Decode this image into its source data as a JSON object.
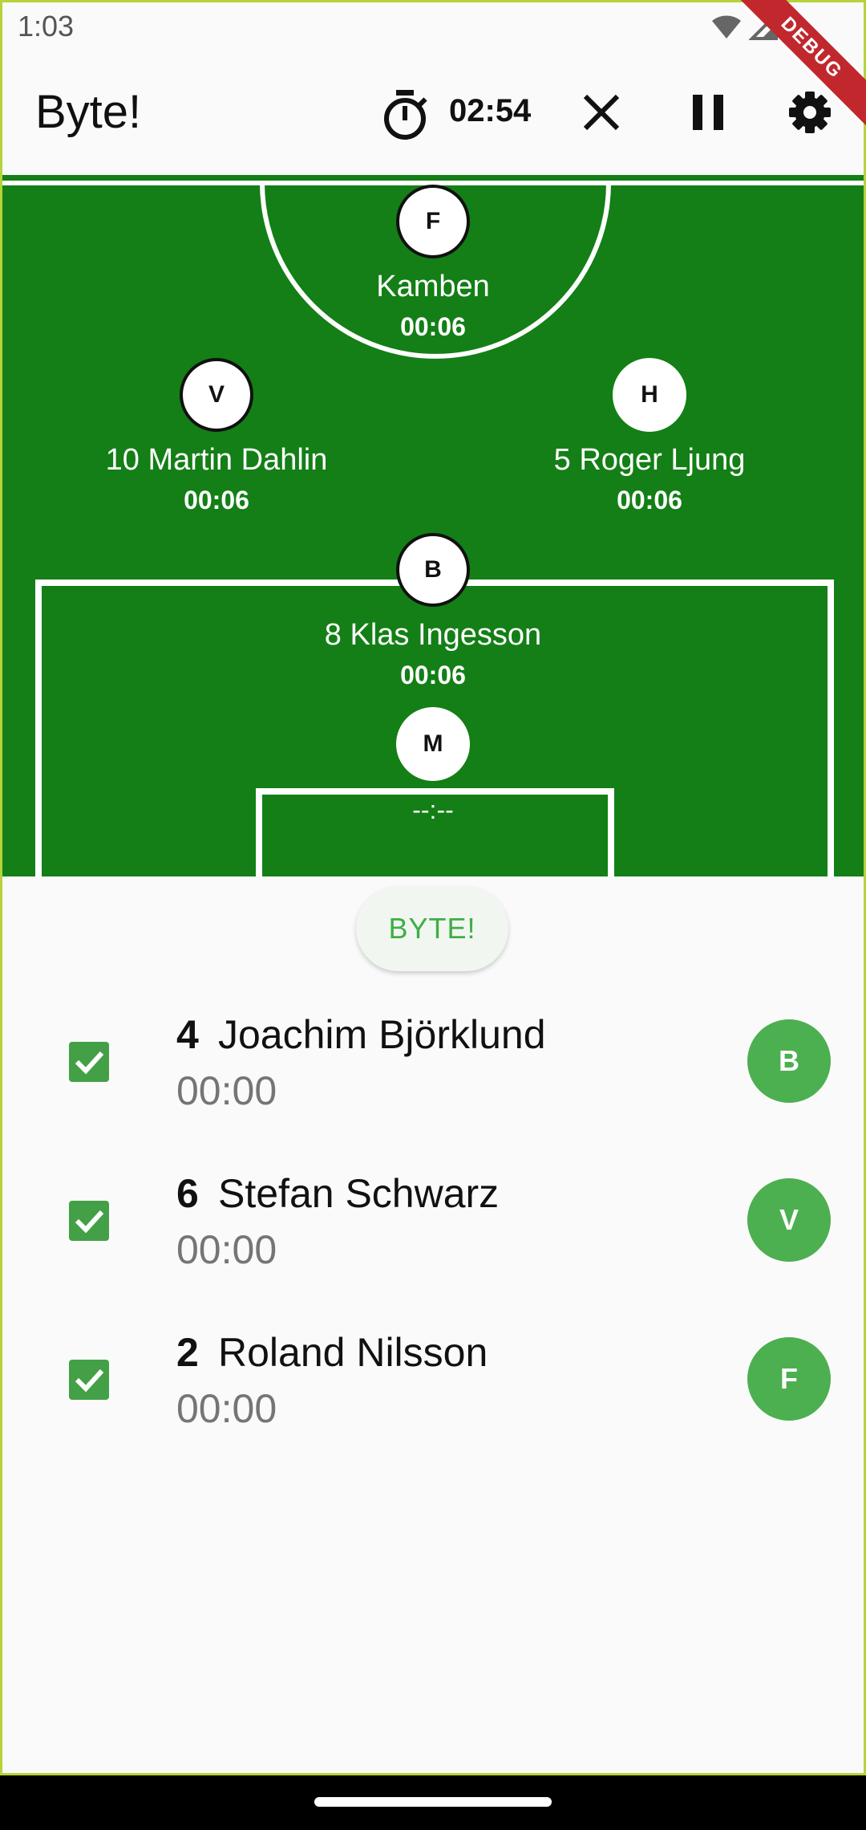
{
  "status_bar": {
    "time": "1:03",
    "debug_label": "DEBUG"
  },
  "app_bar": {
    "title": "Byte!",
    "timer": "02:54",
    "icons": {
      "timer": "stopwatch-icon",
      "close": "close-icon",
      "pause": "pause-icon",
      "settings": "gear-icon"
    }
  },
  "field": {
    "players": [
      {
        "position": "F",
        "name": "Kamben",
        "time": "00:06"
      },
      {
        "position": "V",
        "name": "10 Martin Dahlin",
        "time": "00:06"
      },
      {
        "position": "H",
        "name": "5 Roger Ljung",
        "time": "00:06"
      },
      {
        "position": "B",
        "name": "8 Klas Ingesson",
        "time": "00:06"
      },
      {
        "position": "M",
        "name": "",
        "time": "--:--"
      }
    ]
  },
  "swap_button": {
    "label": "BYTE!"
  },
  "bench": [
    {
      "number": "4",
      "name": "Joachim Björklund",
      "time": "00:00",
      "position": "B",
      "checked": true
    },
    {
      "number": "6",
      "name": "Stefan Schwarz",
      "time": "00:00",
      "position": "V",
      "checked": true
    },
    {
      "number": "2",
      "name": "Roland Nilsson",
      "time": "00:00",
      "position": "F",
      "checked": true
    }
  ],
  "colors": {
    "pitch": "#137f16",
    "accent": "#4caf50",
    "debug": "#c0282e"
  }
}
